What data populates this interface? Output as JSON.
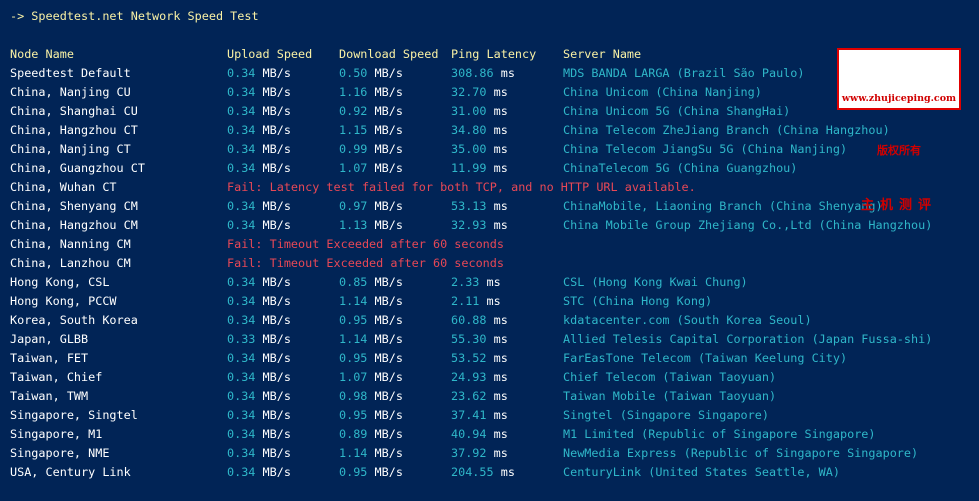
{
  "header": {
    "prompt": "-> Speedtest.net Network Speed Test"
  },
  "columns": {
    "node": "Node Name",
    "upload": "Upload Speed",
    "download": "Download Speed",
    "ping": "Ping Latency",
    "server": "Server Name"
  },
  "units": {
    "speed": "MB/s",
    "ping": "ms"
  },
  "rows": [
    {
      "node": "Speedtest Default",
      "up": "0.34",
      "down": "0.50",
      "ping": "308.86",
      "server": "MDS BANDA LARGA (Brazil São Paulo)"
    },
    {
      "node": "China, Nanjing CU",
      "up": "0.34",
      "down": "1.16",
      "ping": "32.70",
      "server": "China Unicom (China Nanjing)"
    },
    {
      "node": "China, Shanghai CU",
      "up": "0.34",
      "down": "0.92",
      "ping": "31.00",
      "server": "China Unicom 5G (China ShangHai)"
    },
    {
      "node": "China, Hangzhou CT",
      "up": "0.34",
      "down": "1.15",
      "ping": "34.80",
      "server": "China Telecom ZheJiang Branch (China Hangzhou)"
    },
    {
      "node": "China, Nanjing CT",
      "up": "0.34",
      "down": "0.99",
      "ping": "35.00",
      "server": "China Telecom JiangSu 5G (China Nanjing)"
    },
    {
      "node": "China, Guangzhou CT",
      "up": "0.34",
      "down": "1.07",
      "ping": "11.99",
      "server": "ChinaTelecom 5G (China Guangzhou)"
    },
    {
      "node": "China, Wuhan CT",
      "fail": "Fail: Latency test failed for both TCP, and no HTTP URL available."
    },
    {
      "node": "China, Shenyang CM",
      "up": "0.34",
      "down": "0.97",
      "ping": "53.13",
      "server": "ChinaMobile, Liaoning Branch (China Shenyang)"
    },
    {
      "node": "China, Hangzhou CM",
      "up": "0.34",
      "down": "1.13",
      "ping": "32.93",
      "server": "China Mobile Group Zhejiang Co.,Ltd (China Hangzhou)"
    },
    {
      "node": "China, Nanning CM",
      "fail": "Fail: Timeout Exceeded after 60 seconds"
    },
    {
      "node": "China, Lanzhou CM",
      "fail": "Fail: Timeout Exceeded after 60 seconds"
    },
    {
      "node": "Hong Kong, CSL",
      "up": "0.34",
      "down": "0.85",
      "ping": "2.33",
      "server": "CSL (Hong Kong Kwai Chung)"
    },
    {
      "node": "Hong Kong, PCCW",
      "up": "0.34",
      "down": "1.14",
      "ping": "2.11",
      "server": "STC (China Hong Kong)"
    },
    {
      "node": "Korea, South Korea",
      "up": "0.34",
      "down": "0.95",
      "ping": "60.88",
      "server": "kdatacenter.com (South Korea Seoul)"
    },
    {
      "node": "Japan, GLBB",
      "up": "0.33",
      "down": "1.14",
      "ping": "55.30",
      "server": "Allied Telesis Capital Corporation (Japan Fussa-shi)"
    },
    {
      "node": "Taiwan, FET",
      "up": "0.34",
      "down": "0.95",
      "ping": "53.52",
      "server": "FarEasTone Telecom (Taiwan Keelung City)"
    },
    {
      "node": "Taiwan, Chief",
      "up": "0.34",
      "down": "1.07",
      "ping": "24.93",
      "server": "Chief Telecom (Taiwan Taoyuan)"
    },
    {
      "node": "Taiwan, TWM",
      "up": "0.34",
      "down": "0.98",
      "ping": "23.62",
      "server": "Taiwan Mobile (Taiwan Taoyuan)"
    },
    {
      "node": "Singapore, Singtel",
      "up": "0.34",
      "down": "0.95",
      "ping": "37.41",
      "server": "Singtel (Singapore Singapore)"
    },
    {
      "node": "Singapore, M1",
      "up": "0.34",
      "down": "0.89",
      "ping": "40.94",
      "server": "M1 Limited (Republic of Singapore Singapore)"
    },
    {
      "node": "Singapore, NME",
      "up": "0.34",
      "down": "1.14",
      "ping": "37.92",
      "server": "NewMedia Express (Republic of Singapore Singapore)"
    },
    {
      "node": "USA, Century Link",
      "up": "0.34",
      "down": "0.95",
      "ping": "204.55",
      "server": "CenturyLink (United States Seattle, WA)"
    }
  ],
  "watermark": {
    "url": "www.zhujiceping.com",
    "rights": "版权所有",
    "name": "主机测评"
  },
  "colors": {
    "background": "#012456",
    "header": "#f9f1a5",
    "value": "#2fb7c9",
    "fail": "#e74856",
    "watermark": "#d00000"
  }
}
